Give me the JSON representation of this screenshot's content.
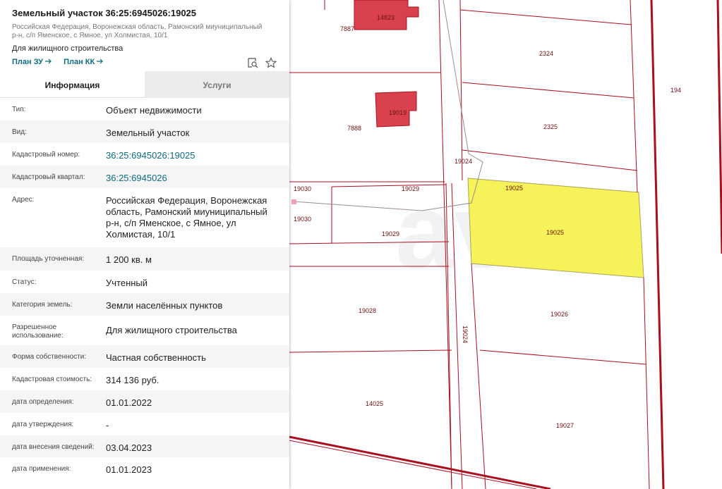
{
  "parcel": {
    "title": "Земельный участок 36:25:6945026:19025",
    "address_lines": [
      "Российская Федерация, Воронежская область, Рамонский миуниципальный",
      "р-н, с/п Яменское, с Ямное, ул Холмистая, 10/1"
    ],
    "permitted_use": "Для жилищного строительства",
    "links": {
      "plan_zu": "План ЗУ",
      "plan_kk": "План КК"
    },
    "icons": {
      "search": "search-map-icon",
      "favorite": "star-icon",
      "arrow": "arrow-right-icon"
    }
  },
  "tabs": {
    "info": "Информация",
    "services": "Услуги"
  },
  "info_rows": [
    {
      "key": "Тип:",
      "value": "Объект недвижимости"
    },
    {
      "key": "Вид:",
      "value": "Земельный участок"
    },
    {
      "key": "Кадастровый номер:",
      "value": "36:25:6945026:19025"
    },
    {
      "key": "Кадастровый квартал:",
      "value": "36:25:6945026"
    },
    {
      "key": "Адрес:",
      "value_lines": [
        "Российская Федерация, Воронежская",
        "область, Рамонский миуниципальный",
        "р-н, с/п Яменское, с Ямное, ул",
        "Холмистая, 10/1"
      ]
    },
    {
      "key": "Площадь уточненная:",
      "value": "1 200 кв. м"
    },
    {
      "key": "Статус:",
      "value": "Учтенный"
    },
    {
      "key": "Категория земель:",
      "value": "Земли населённых пунктов"
    },
    {
      "key_lines": [
        "Разрешенное",
        "использование:"
      ],
      "value": "Для жилищного строительства"
    },
    {
      "key": "Форма собственности:",
      "value": "Частная собственность"
    },
    {
      "key": "Кадастровая стоимость:",
      "value": "314 136 руб."
    },
    {
      "key": "дата определения:",
      "value": "01.01.2022"
    },
    {
      "key": "дата утверждения:",
      "value": "-"
    },
    {
      "key": "дата внесения сведений:",
      "value": "03.04.2023"
    },
    {
      "key": "дата применения:",
      "value": "01.01.2023"
    }
  ],
  "map": {
    "labels": {
      "b14823": "14823",
      "p7887": "7887",
      "p2324": "2324",
      "p194": "194",
      "b19019": "19019",
      "p7888": "7888",
      "p2325": "2325",
      "road19024a": "19024",
      "p19030a": "19030",
      "p19029a": "19029",
      "p19025a": "19025",
      "p19030b": "19030",
      "p19029b": "19029",
      "p19025b": "19025",
      "p19028": "19028",
      "road19024b": "19024",
      "p19026": "19026",
      "p14025": "14025",
      "p19027": "19027"
    },
    "colors": {
      "boundary": "#a80f1f",
      "building": "#d9424c",
      "selected": "#f6f35a",
      "cadastral_blue": "#0e6a7e"
    }
  }
}
